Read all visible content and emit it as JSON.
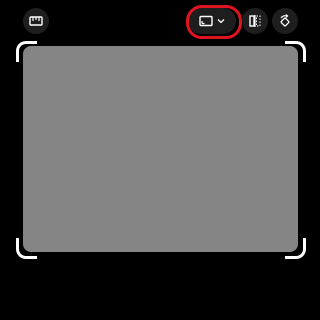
{
  "toolbar": {
    "ruler_icon": "ruler-icon",
    "aspect_icon": "aspect-ratio-icon",
    "dropdown_icon": "chevron-down-icon",
    "flip_icon": "flip-icon",
    "rotate_icon": "rotate-icon"
  },
  "colors": {
    "background": "#000000",
    "button_bg": "#1e1e1e",
    "icon": "#ffffff",
    "crop_fill": "#858585",
    "highlight": "#e0141e"
  }
}
